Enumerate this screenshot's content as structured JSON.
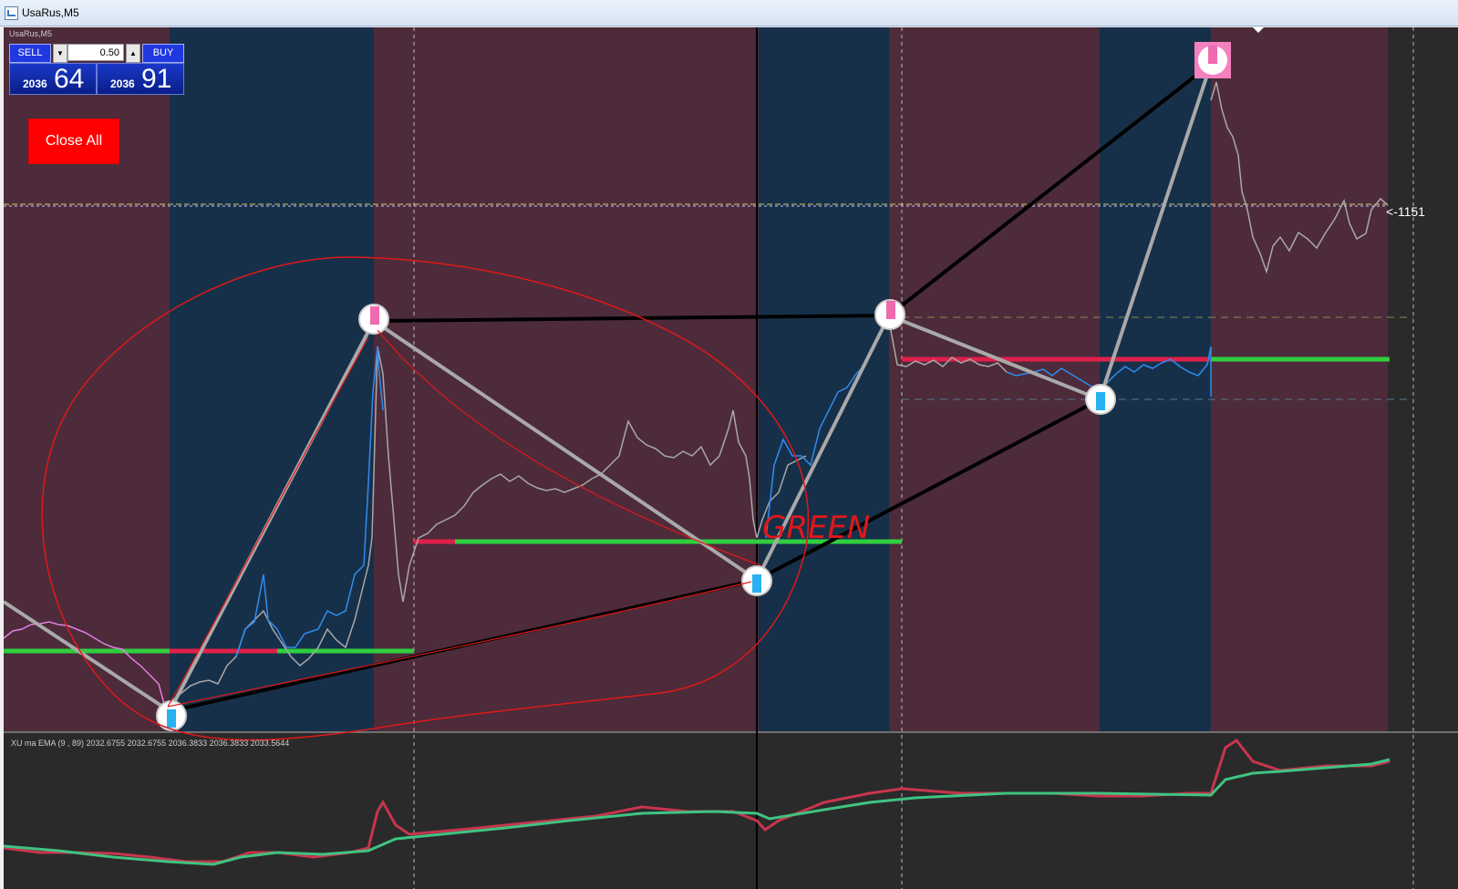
{
  "window": {
    "title": "UsaRus,M5"
  },
  "chart": {
    "symbol_label": "UsaRus,M5",
    "indicator_label": "XU ma  EMA (9 , 89) 2032.6755 2032.6755 2036.3833 2036.3833 2033.5644",
    "price_tag": "<-1151",
    "annotation": "GREEN",
    "colors": {
      "bg": "#2a2a2a",
      "pink_zone": "#4d2b3b",
      "blue_zone": "#17304a",
      "ema_red": "#c8354e",
      "ema_green": "#3fc381"
    }
  },
  "trade_panel": {
    "sell_label": "SELL",
    "buy_label": "BUY",
    "lot": "0.50",
    "sell_price_small": "2036",
    "sell_price_big": "64",
    "buy_price_small": "2036",
    "buy_price_big": "91"
  },
  "close_all_label": "Close All"
}
